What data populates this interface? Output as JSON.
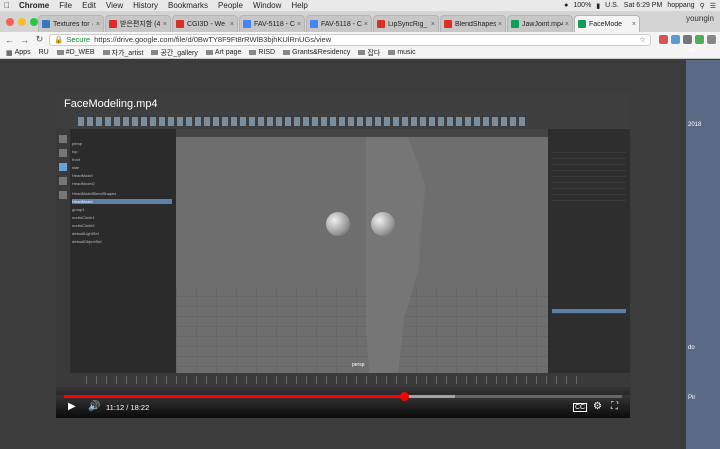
{
  "menubar": {
    "app": "Chrome",
    "items": [
      "File",
      "Edit",
      "View",
      "History",
      "Bookmarks",
      "People",
      "Window",
      "Help"
    ],
    "battery": "100%",
    "input_source": "U.S.",
    "clock": "Sat 6:29 PM",
    "user": "hoppang"
  },
  "tabs": [
    {
      "title": "Textures for ·",
      "color": "#3a76c4",
      "active": false
    },
    {
      "title": "받은편지함 (4",
      "color": "#d93025",
      "active": false
    },
    {
      "title": "CGI3D - We",
      "color": "#d93025",
      "active": false
    },
    {
      "title": "FAV-5118 - C",
      "color": "#4285f4",
      "active": false
    },
    {
      "title": "FAV-5118 - C",
      "color": "#4285f4",
      "active": false
    },
    {
      "title": "LipSyncRig_",
      "color": "#d93025",
      "active": false
    },
    {
      "title": "BlendShapes",
      "color": "#d93025",
      "active": false
    },
    {
      "title": "JawJoint.mp4",
      "color": "#0f9d58",
      "active": false
    },
    {
      "title": "FaceMode",
      "color": "#0f9d58",
      "active": true
    }
  ],
  "profile": "youngin",
  "address": {
    "secure_label": "Secure",
    "url": "https://drive.google.com/file/d/0BwTY8F9Ft8rRWlB3bjhKUlRnUGs/view"
  },
  "bookmarks": [
    "Apps",
    "RU",
    "#D_WEB",
    "자가_artist",
    "공간_gallery",
    "Art page",
    "RISD",
    "Grants&Residency",
    "잡다",
    "music"
  ],
  "video": {
    "title": "FaceModeling.mp4",
    "current_time": "11:12",
    "separator": " / ",
    "duration": "18:22",
    "progress": 0.61,
    "buffered": 0.7
  },
  "maya": {
    "outliner_rows": [
      "persp",
      "top",
      "front",
      "side",
      "HeadModel",
      "HeadModel2",
      "HeadModelBlendShapes",
      "HeadModel",
      "group1",
      "nurbsCircle1",
      "nurbsCircle2",
      "defaultLightSet",
      "defaultObjectSet"
    ],
    "panel_label": "persp"
  },
  "sidebar_right": [
    "AE",
    "2018",
    "do",
    "Pir"
  ]
}
